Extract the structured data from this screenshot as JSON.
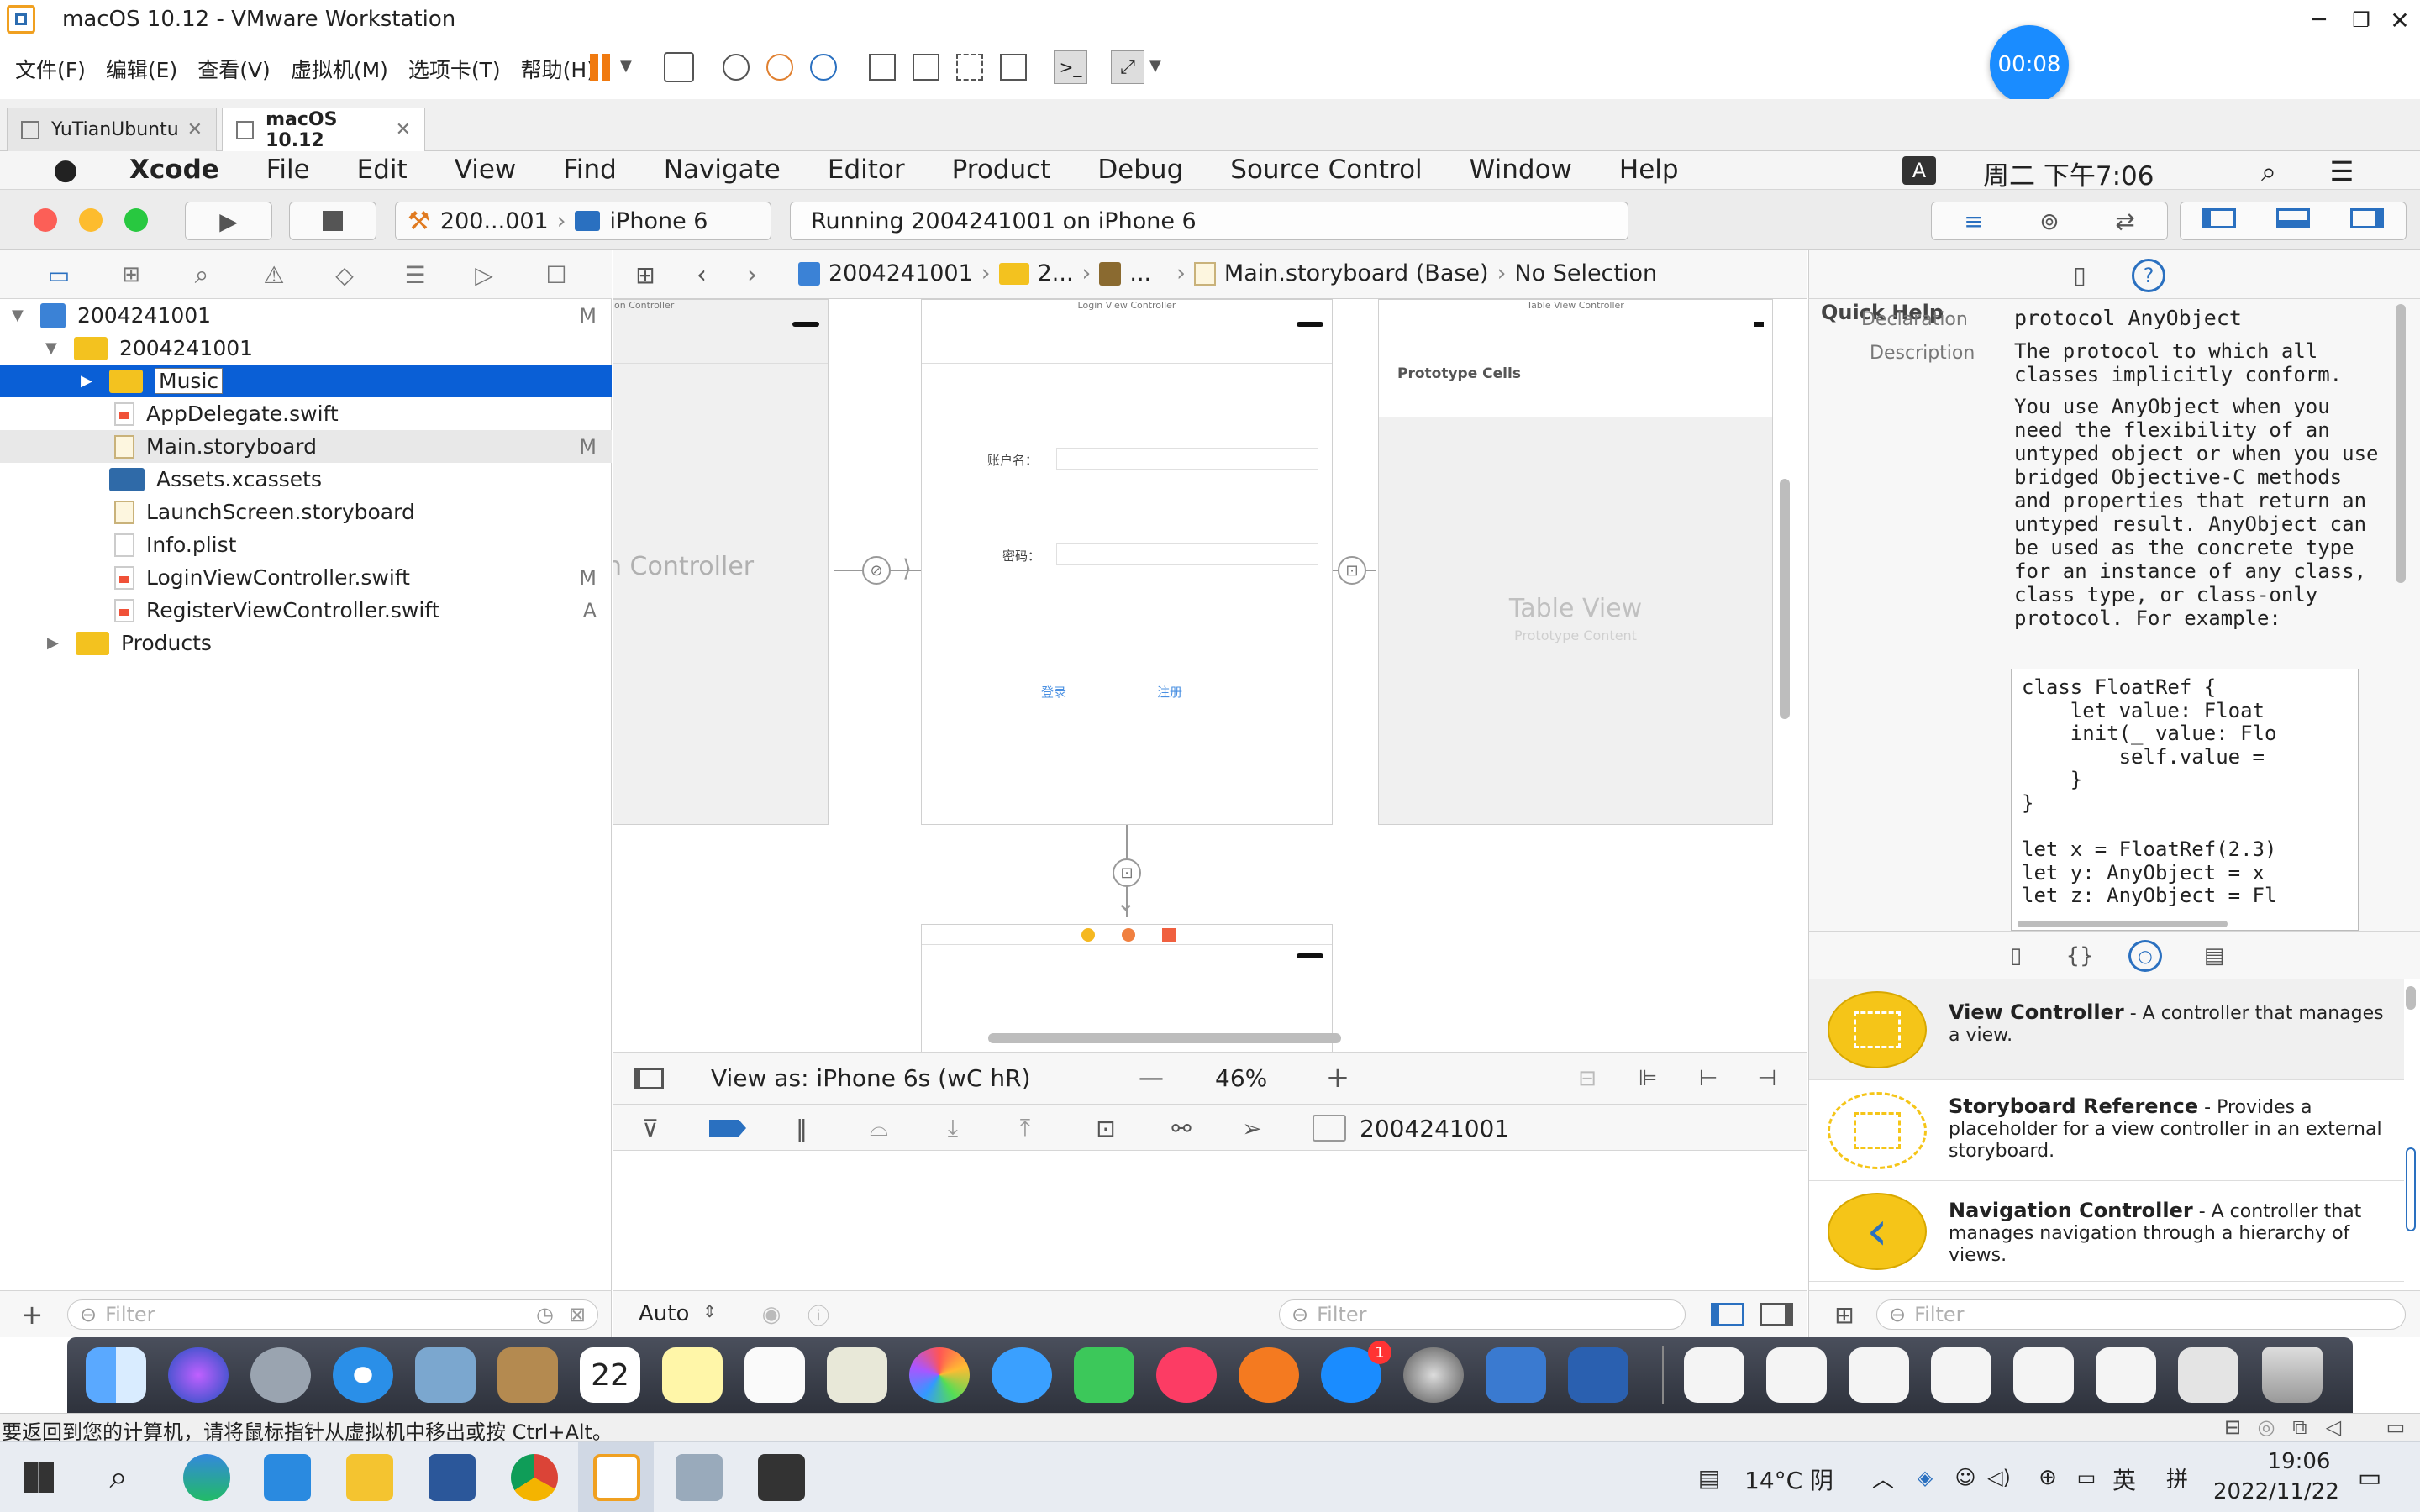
{
  "vmware": {
    "title": "macOS 10.12 - VMware Workstation",
    "menu": [
      "文件(F)",
      "编辑(E)",
      "查看(V)",
      "虚拟机(M)",
      "选项卡(T)",
      "帮助(H)"
    ],
    "timer": "00:08",
    "tabs": [
      {
        "label": "YuTianUbuntu",
        "active": false
      },
      {
        "label": "macOS 10.12",
        "active": true
      }
    ],
    "status_text": "要返回到您的计算机，请将鼠标指针从虚拟机中移出或按 Ctrl+Alt。"
  },
  "mac_menubar": {
    "items": [
      "Xcode",
      "File",
      "Edit",
      "View",
      "Find",
      "Navigate",
      "Editor",
      "Product",
      "Debug",
      "Source Control",
      "Window",
      "Help"
    ],
    "input_indicator": "A",
    "clock": "周二 下午7:06"
  },
  "xcode_toolbar": {
    "scheme": "200...001",
    "device": "iPhone 6",
    "activity": "Running 2004241001 on iPhone 6"
  },
  "navigator": {
    "rows": [
      {
        "label": "2004241001",
        "badge": "M",
        "depth": 0,
        "kind": "project",
        "disclosure": "open"
      },
      {
        "label": "2004241001",
        "badge": "",
        "depth": 1,
        "kind": "folder",
        "disclosure": "open"
      },
      {
        "label": "Music",
        "badge": "",
        "depth": 2,
        "kind": "folder",
        "disclosure": "closed",
        "selected": true
      },
      {
        "label": "AppDelegate.swift",
        "badge": "",
        "depth": 3,
        "kind": "swift"
      },
      {
        "label": "Main.storyboard",
        "badge": "M",
        "depth": 3,
        "kind": "storyboard",
        "highlighted": true
      },
      {
        "label": "Assets.xcassets",
        "badge": "",
        "depth": 3,
        "kind": "assets"
      },
      {
        "label": "LaunchScreen.storyboard",
        "badge": "",
        "depth": 3,
        "kind": "storyboard"
      },
      {
        "label": "Info.plist",
        "badge": "",
        "depth": 3,
        "kind": "plist"
      },
      {
        "label": "LoginViewController.swift",
        "badge": "M",
        "depth": 3,
        "kind": "swift"
      },
      {
        "label": "RegisterViewController.swift",
        "badge": "A",
        "depth": 3,
        "kind": "swift"
      },
      {
        "label": "Products",
        "badge": "",
        "depth": 1,
        "kind": "folder",
        "disclosure": "closed"
      }
    ],
    "filter_placeholder": "Filter"
  },
  "jump_bar": {
    "crumbs": [
      "2004241001",
      "2...",
      "...",
      "Main.storyboard (Base)",
      "No Selection"
    ]
  },
  "canvas": {
    "scene1_title": "on Controller",
    "scene1_label": "n Controller",
    "scene2_title": "Login View Controller",
    "username_label": "账户名：",
    "password_label": "密码：",
    "login_button": "登录",
    "register_button": "注册",
    "scene3_title": "Table View Controller",
    "prototype_cells": "Prototype Cells",
    "table_view": "Table View",
    "prototype_content": "Prototype Content"
  },
  "canvas_bottom": {
    "view_as": "View as: iPhone 6s (wC hR)",
    "zoom": "46%"
  },
  "debug_bar": {
    "target": "2004241001"
  },
  "debug_footer": {
    "auto_label": "Auto",
    "filter_placeholder": "Filter"
  },
  "quick_help": {
    "header": "Quick Help",
    "declaration_label": "Declaration",
    "declaration": "protocol AnyObject",
    "description_label": "Description",
    "desc1": "The protocol to which all classes implicitly conform.",
    "desc2": "You use AnyObject when you need the flexibility of an untyped object or when you use bridged Objective-C methods and properties that return an untyped result. AnyObject can be used as the concrete type for an instance of any class, class type, or class-only protocol. For example:",
    "code": "class FloatRef {\n    let value: Float\n    init(_ value: Flo\n        self.value = \n    }\n}\n\nlet x = FloatRef(2.3)\nlet y: AnyObject = x\nlet z: AnyObject = Fl"
  },
  "library": {
    "items": [
      {
        "title": "View Controller",
        "desc": " - A controller that manages a view."
      },
      {
        "title": "Storyboard Reference",
        "desc": " - Provides a placeholder for a view controller in an external storyboard."
      },
      {
        "title": "Navigation Controller",
        "desc": " - A controller that manages navigation through a hierarchy of views."
      }
    ],
    "filter_placeholder": "Filter"
  },
  "dock": {
    "calendar_day": "22",
    "appstore_badge": "1"
  },
  "taskbar": {
    "weather": "14°C 阴",
    "ime": "英",
    "ime2": "拼",
    "time": "19:06",
    "date": "2022/11/22"
  },
  "colors": {
    "selection": "#0a5fd6",
    "folder": "#f3c21f",
    "accent_blue": "#1a8cff"
  }
}
